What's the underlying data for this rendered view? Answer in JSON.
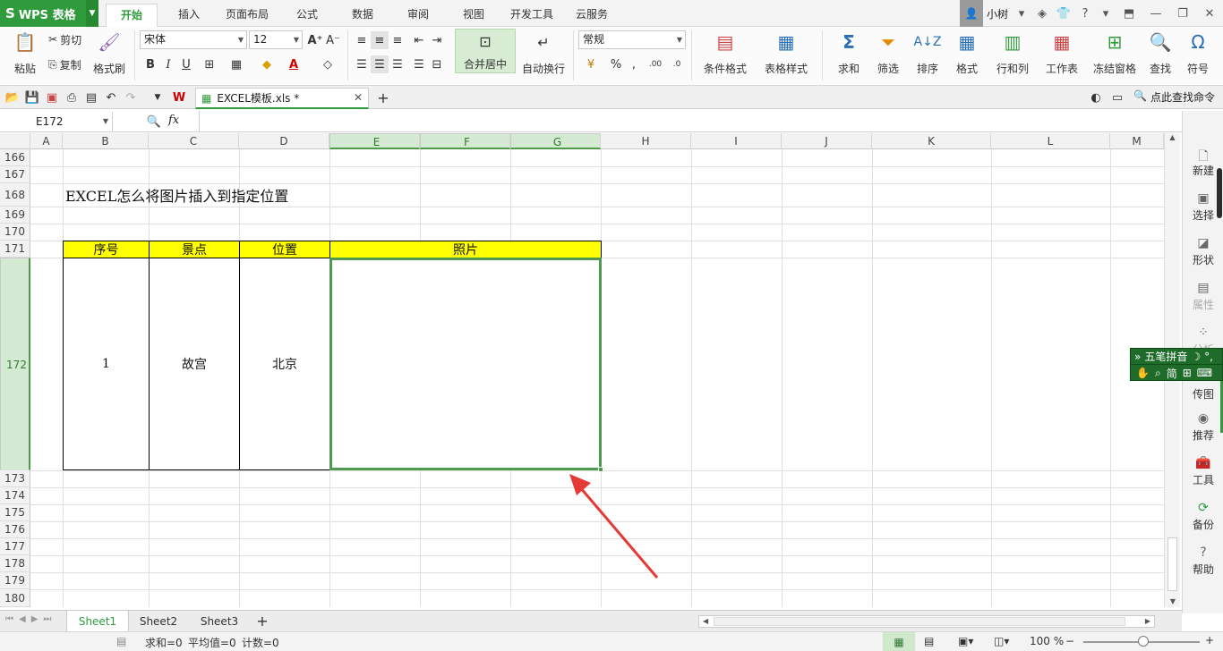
{
  "app": {
    "logo_label": "WPS 表格"
  },
  "menu": {
    "tabs": [
      {
        "label": "开始",
        "active": true
      },
      {
        "label": "插入"
      },
      {
        "label": "页面布局"
      },
      {
        "label": "公式"
      },
      {
        "label": "数据"
      },
      {
        "label": "审阅"
      },
      {
        "label": "视图"
      },
      {
        "label": "开发工具"
      },
      {
        "label": "云服务"
      }
    ],
    "user_name": "小树"
  },
  "ribbon": {
    "paste": "粘贴",
    "cut": "剪切",
    "copy": "复制",
    "format_painter": "格式刷",
    "font_name": "宋体",
    "font_size": "12",
    "merge_center": "合并居中",
    "wrap_text": "自动换行",
    "number_format": "常规",
    "conditional_format": "条件格式",
    "table_style": "表格样式",
    "sum": "求和",
    "filter": "筛选",
    "sort": "排序",
    "format": "格式",
    "rows_cols": "行和列",
    "worksheet": "工作表",
    "freeze": "冻结窗格",
    "find": "查找",
    "symbol": "符号"
  },
  "doc": {
    "tab_label": "EXCEL模板.xls *",
    "search_cmd": "点此查找命令"
  },
  "formula": {
    "name_box": "E172",
    "fx": "fx",
    "content": ""
  },
  "grid": {
    "columns": [
      "A",
      "B",
      "C",
      "D",
      "E",
      "F",
      "G",
      "H",
      "I",
      "J",
      "K",
      "L",
      "M"
    ],
    "rows": [
      "166",
      "167",
      "168",
      "169",
      "170",
      "171",
      "172",
      "173",
      "174",
      "175",
      "176",
      "177",
      "178",
      "179",
      "180"
    ],
    "title_text": "EXCEL怎么将图片插入到指定位置",
    "table_headers": [
      "序号",
      "景点",
      "位置",
      "照片"
    ],
    "table_row": [
      "1",
      "故宫",
      "北京",
      ""
    ]
  },
  "sidebar": {
    "items": [
      "新建",
      "选择",
      "形状",
      "属性",
      "分析",
      "传图",
      "推荐",
      "工具",
      "备份",
      "帮助"
    ]
  },
  "ime": {
    "line1": "五笔拼音",
    "line2": "简"
  },
  "sheets": {
    "tabs": [
      "Sheet1",
      "Sheet2",
      "Sheet3"
    ],
    "add": "+"
  },
  "status": {
    "sum": "求和=0",
    "avg": "平均值=0",
    "count": "计数=0",
    "zoom": "100 %"
  },
  "colors": {
    "accent": "#2f9b3c",
    "header_fill": "#ffff00",
    "selection": "#4f9a4f",
    "arrow": "#e53935"
  }
}
